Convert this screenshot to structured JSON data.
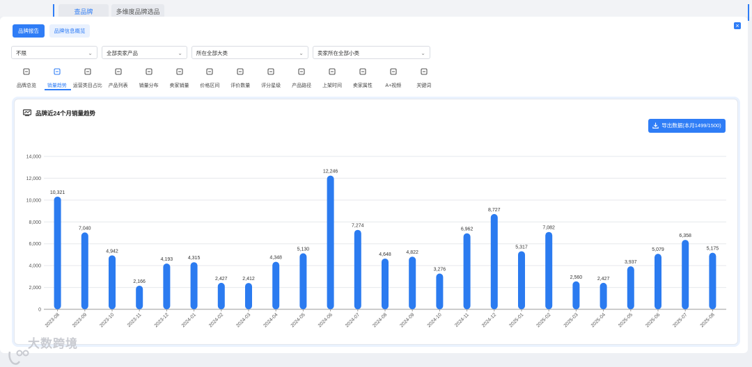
{
  "top_tabs": [
    "查品牌",
    "多维度品牌选品"
  ],
  "buttons": {
    "brand_report": "品牌报告",
    "brand_info": "品牌信息概览"
  },
  "filters": [
    {
      "value": "不限"
    },
    {
      "value": "全部卖家产品"
    },
    {
      "value": "所在全部大类"
    },
    {
      "value": "卖家所在全部小类"
    }
  ],
  "nav": [
    {
      "label": "品牌总览",
      "icon": "overview-icon"
    },
    {
      "label": "销量趋势",
      "icon": "trend-icon",
      "active": true
    },
    {
      "label": "运营类目占比",
      "icon": "category-icon"
    },
    {
      "label": "产品列表",
      "icon": "list-icon"
    },
    {
      "label": "销量分布",
      "icon": "bar-chart-icon"
    },
    {
      "label": "卖家销量",
      "icon": "seller-icon"
    },
    {
      "label": "价格区间",
      "icon": "price-icon"
    },
    {
      "label": "评价数量",
      "icon": "review-icon"
    },
    {
      "label": "评分星级",
      "icon": "star-icon"
    },
    {
      "label": "产品路径",
      "icon": "path-icon"
    },
    {
      "label": "上架时间",
      "icon": "calendar-icon"
    },
    {
      "label": "卖家属性",
      "icon": "store-icon"
    },
    {
      "label": "A+视频",
      "icon": "pie-icon"
    },
    {
      "label": "关键词",
      "icon": "keyword-icon"
    }
  ],
  "export_label": "导出数据(本月1499/1500)",
  "watermark": "大数跨境",
  "colors": {
    "accent": "#2f7df6",
    "bar": "#2b7bf0"
  },
  "chart_data": {
    "type": "bar",
    "title": "品牌近24个月销量趋势",
    "categories": [
      "2023-08",
      "2023-09",
      "2023-10",
      "2023-11",
      "2023-12",
      "2024-01",
      "2024-02",
      "2024-03",
      "2024-04",
      "2024-05",
      "2024-06",
      "2024-07",
      "2024-08",
      "2024-09",
      "2024-10",
      "2024-11",
      "2024-12",
      "2025-01",
      "2025-02",
      "2025-03",
      "2025-04",
      "2025-05",
      "2025-06",
      "2025-07",
      "2025-08"
    ],
    "values": [
      10321,
      7040,
      4942,
      2166,
      4193,
      4315,
      2427,
      2412,
      4348,
      5130,
      12246,
      7274,
      4648,
      4822,
      3276,
      6962,
      8727,
      5317,
      7082,
      2560,
      2427,
      3937,
      5079,
      6358,
      5175
    ],
    "value_labels": [
      "10,321",
      "7,040",
      "4,942",
      "2,166",
      "4,193",
      "4,315",
      "2,427",
      "2,412",
      "4,348",
      "5,130",
      "12,246",
      "7,274",
      "4,648",
      "4,822",
      "3,276",
      "6,962",
      "8,727",
      "5,317",
      "7,082",
      "2,560",
      "2,427",
      "3,937",
      "5,079",
      "6,358",
      "5,175"
    ],
    "ylim": [
      0,
      14000
    ],
    "yticks": [
      "0",
      "2,000",
      "4,000",
      "6,000",
      "8,000",
      "10,000",
      "12,000",
      "14,000"
    ],
    "grid": true
  }
}
